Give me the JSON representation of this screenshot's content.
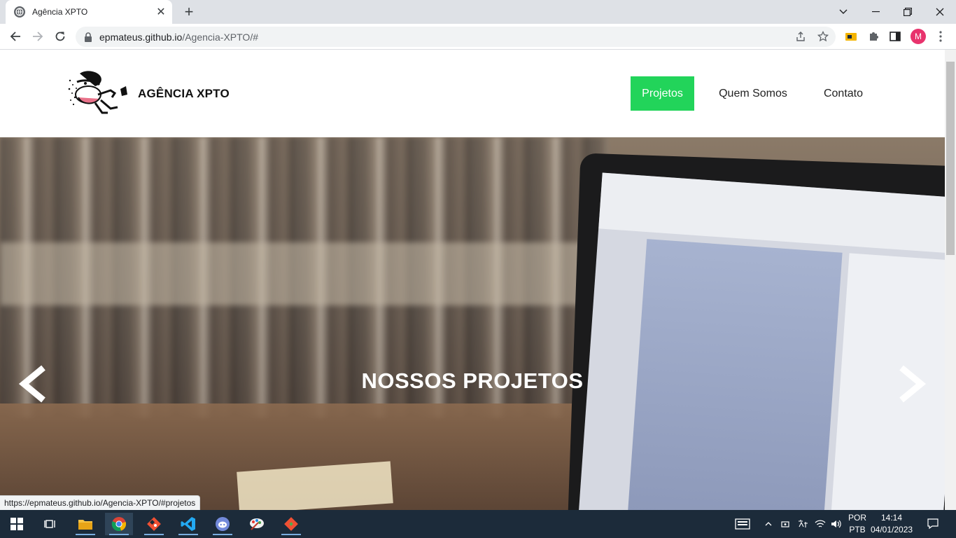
{
  "browser": {
    "tab_title": "Agência XPTO",
    "url_host": "epmateus.github.io",
    "url_path": "/Agencia-XPTO/#",
    "profile_initial": "M",
    "status_url": "https://epmateus.github.io/Agencia-XPTO/#projetos"
  },
  "site": {
    "brand": "AGÊNCIA XPTO",
    "nav": [
      {
        "label": "Projetos",
        "active": true
      },
      {
        "label": "Quem Somos",
        "active": false
      },
      {
        "label": "Contato",
        "active": false
      }
    ],
    "hero_title": "NOSSOS PROJETOS"
  },
  "taskbar": {
    "lang_1": "POR",
    "lang_2": "PTB",
    "time": "14:14",
    "date": "04/01/2023"
  },
  "colors": {
    "accent": "#22d45a",
    "taskbar": "#1c2b3a",
    "avatar": "#e8336d"
  }
}
